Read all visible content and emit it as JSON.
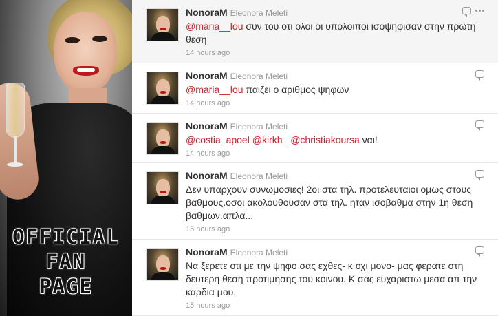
{
  "promo": {
    "banner_lines": [
      "OFFICIAL",
      "FAN",
      "PAGE"
    ]
  },
  "tweets": [
    {
      "screen_name": "NonoraM",
      "full_name": "Eleonora Meleti",
      "mentions": [
        "maria__lou"
      ],
      "text": " συν του οτι ολοι οι υπολοιποι ισοψηφισαν στην πρωτη θεση",
      "time": "14 hours ago",
      "hovered": true
    },
    {
      "screen_name": "NonoraM",
      "full_name": "Eleonora Meleti",
      "mentions": [
        "maria__lou"
      ],
      "text": " παιζει ο αριθμος ψηφων",
      "time": "14 hours ago",
      "hovered": false
    },
    {
      "screen_name": "NonoraM",
      "full_name": "Eleonora Meleti",
      "mentions": [
        "costia_apoel",
        "kirkh_",
        "christiakoursa"
      ],
      "text": " ναι!",
      "time": "14 hours ago",
      "hovered": false
    },
    {
      "screen_name": "NonoraM",
      "full_name": "Eleonora Meleti",
      "mentions": [],
      "text": "Δεν υπαρχουν συνωμοσιες! 2οι στα τηλ. προτελευταιοι ομως στους βαθμους.οσοι ακολουθουσαν στα τηλ. ηταν ισοβαθμα στην 1η θεση βαθμων.απλα...",
      "time": "15 hours ago",
      "hovered": false
    },
    {
      "screen_name": "NonoraM",
      "full_name": "Eleonora Meleti",
      "mentions": [],
      "text": "Να ξερετε οτι με την ψηφο σας εχθες- κ οχι μονο- μας φερατε στη δευτερη θεση προτιμησης του κοινου. Κ σας ευχαριστω μεσα απ την καρδια μου.",
      "time": "15 hours ago",
      "hovered": false
    }
  ],
  "colors": {
    "mention": "#cc2229",
    "screen_name": "#333333",
    "meta": "#999999",
    "hover_bg": "#f5f5f5"
  },
  "icons": {
    "reply": "reply-icon",
    "more": "more-icon"
  }
}
